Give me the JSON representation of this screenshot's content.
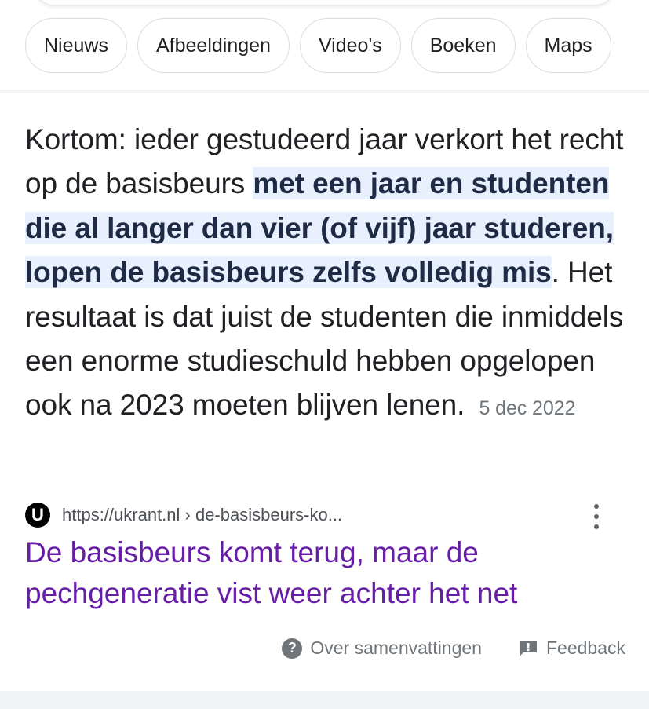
{
  "chips": [
    "Nieuws",
    "Afbeeldingen",
    "Video's",
    "Boeken",
    "Maps"
  ],
  "snippet": {
    "text_before": "Kortom: ieder gestudeerd jaar verkort het recht op de basisbeurs ",
    "highlight": "met een jaar en studenten die al langer dan vier (of vijf) jaar studeren, lopen de basisbeurs zelfs volledig mis",
    "text_after": ". Het resultaat is dat juist de studenten die inmiddels een enorme studieschuld hebben opgelopen ook na 2023 moeten blijven lenen.",
    "date": "5 dec 2022"
  },
  "source": {
    "favicon_letter": "U",
    "url": "https://ukrant.nl › de-basisbeurs-ko..."
  },
  "result": {
    "title": "De basisbeurs komt terug, maar de pechgeneratie vist weer achter het net"
  },
  "footer": {
    "about_label": "Over samenvattingen",
    "feedback_label": "Feedback"
  },
  "colors": {
    "highlight_bg": "#e8f0fe",
    "visited_link": "#681da8",
    "secondary_text": "#70757a"
  },
  "icons": {
    "about": "question-circle-icon",
    "feedback": "feedback-icon",
    "menu": "more-vert-icon"
  }
}
